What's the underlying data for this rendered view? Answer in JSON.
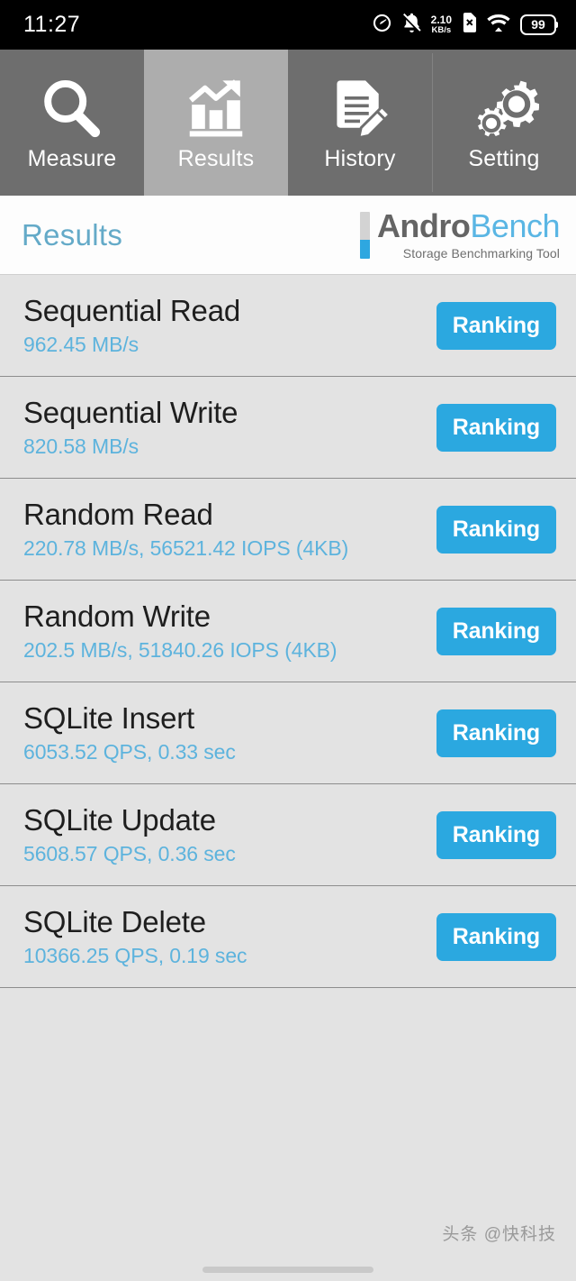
{
  "status_bar": {
    "clock": "11:27",
    "icons": [
      "speedometer-icon",
      "notifications-off-icon",
      "network-speed",
      "sim-card-off-icon",
      "wifi-icon",
      "battery"
    ],
    "net_speed_value": "2.10",
    "net_speed_unit": "KB/s",
    "battery_level": "99"
  },
  "tabs": [
    {
      "label": "Measure",
      "icon": "magnifier-icon",
      "active": false
    },
    {
      "label": "Results",
      "icon": "bar-chart-arrow-icon",
      "active": true
    },
    {
      "label": "History",
      "icon": "document-pencil-icon",
      "active": false
    },
    {
      "label": "Setting",
      "icon": "gears-icon",
      "active": false
    }
  ],
  "header": {
    "title": "Results",
    "logo_primary": "Andro",
    "logo_secondary": "Bench",
    "logo_tagline": "Storage Benchmarking Tool"
  },
  "results": [
    {
      "title": "Sequential Read",
      "value": "962.45 MB/s",
      "button": "Ranking"
    },
    {
      "title": "Sequential Write",
      "value": "820.58 MB/s",
      "button": "Ranking"
    },
    {
      "title": "Random Read",
      "value": "220.78 MB/s, 56521.42 IOPS (4KB)",
      "button": "Ranking"
    },
    {
      "title": "Random Write",
      "value": "202.5 MB/s, 51840.26 IOPS (4KB)",
      "button": "Ranking"
    },
    {
      "title": "SQLite Insert",
      "value": "6053.52 QPS, 0.33 sec",
      "button": "Ranking"
    },
    {
      "title": "SQLite Update",
      "value": "5608.57 QPS, 0.36 sec",
      "button": "Ranking"
    },
    {
      "title": "SQLite Delete",
      "value": "10366.25 QPS, 0.19 sec",
      "button": "Ranking"
    }
  ],
  "footer": {
    "watermark": "头条 @快科技"
  },
  "colors": {
    "accent_blue": "#2ba8e0",
    "value_blue": "#5db3dd",
    "title_blue": "#64aac8",
    "tab_bar": "#6e6e6e",
    "tab_active": "#adadad",
    "list_bg": "#e3e3e3"
  }
}
